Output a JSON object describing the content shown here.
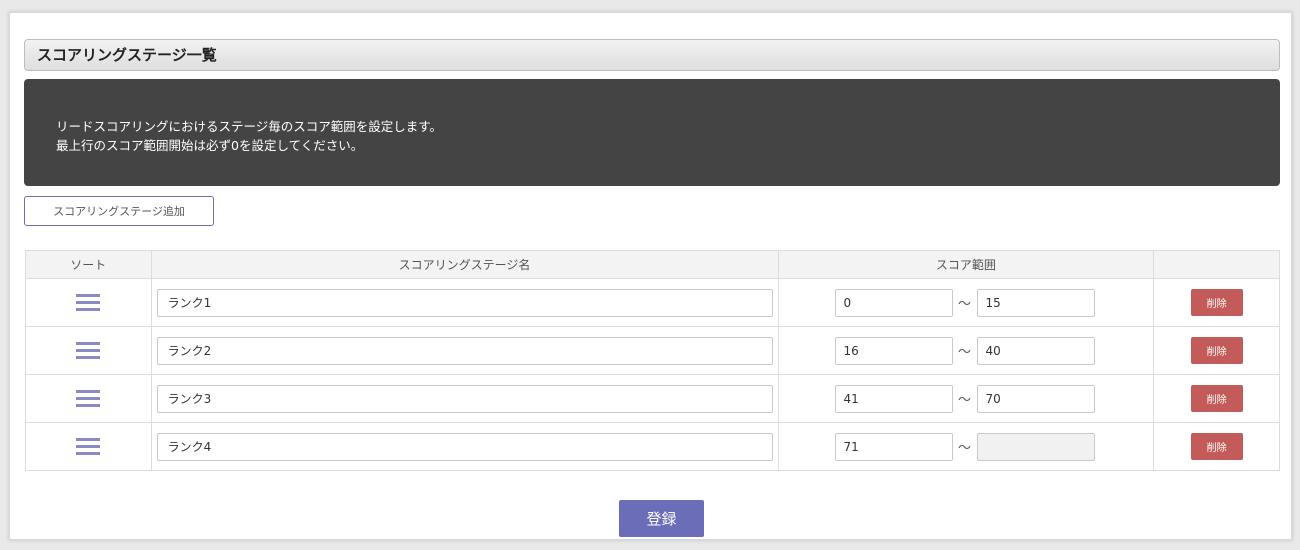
{
  "page": {
    "section_title": "スコアリングステージ一覧",
    "info_lines": [
      "リードスコアリングにおけるステージ毎のスコア範囲を設定します。",
      "最上行のスコア範囲開始は必ず0を設定してください。"
    ],
    "add_button_label": "スコアリングステージ追加",
    "submit_button_label": "登録"
  },
  "table": {
    "headers": {
      "sort": "ソート",
      "name": "スコアリングステージ名",
      "range": "スコア範囲",
      "actions": ""
    },
    "range_separator": "～",
    "delete_label": "削除",
    "rows": [
      {
        "name": "ランク1",
        "range_start": "0",
        "range_end": "15"
      },
      {
        "name": "ランク2",
        "range_start": "16",
        "range_end": "40"
      },
      {
        "name": "ランク3",
        "range_start": "41",
        "range_end": "70"
      },
      {
        "name": "ランク4",
        "range_start": "71",
        "range_end": ""
      }
    ]
  },
  "colors": {
    "info_background": "#444444",
    "accent": "#6b6db8",
    "delete": "#c45b5b"
  },
  "icons": {
    "sort_handle": "hamburger-drag-icon"
  }
}
